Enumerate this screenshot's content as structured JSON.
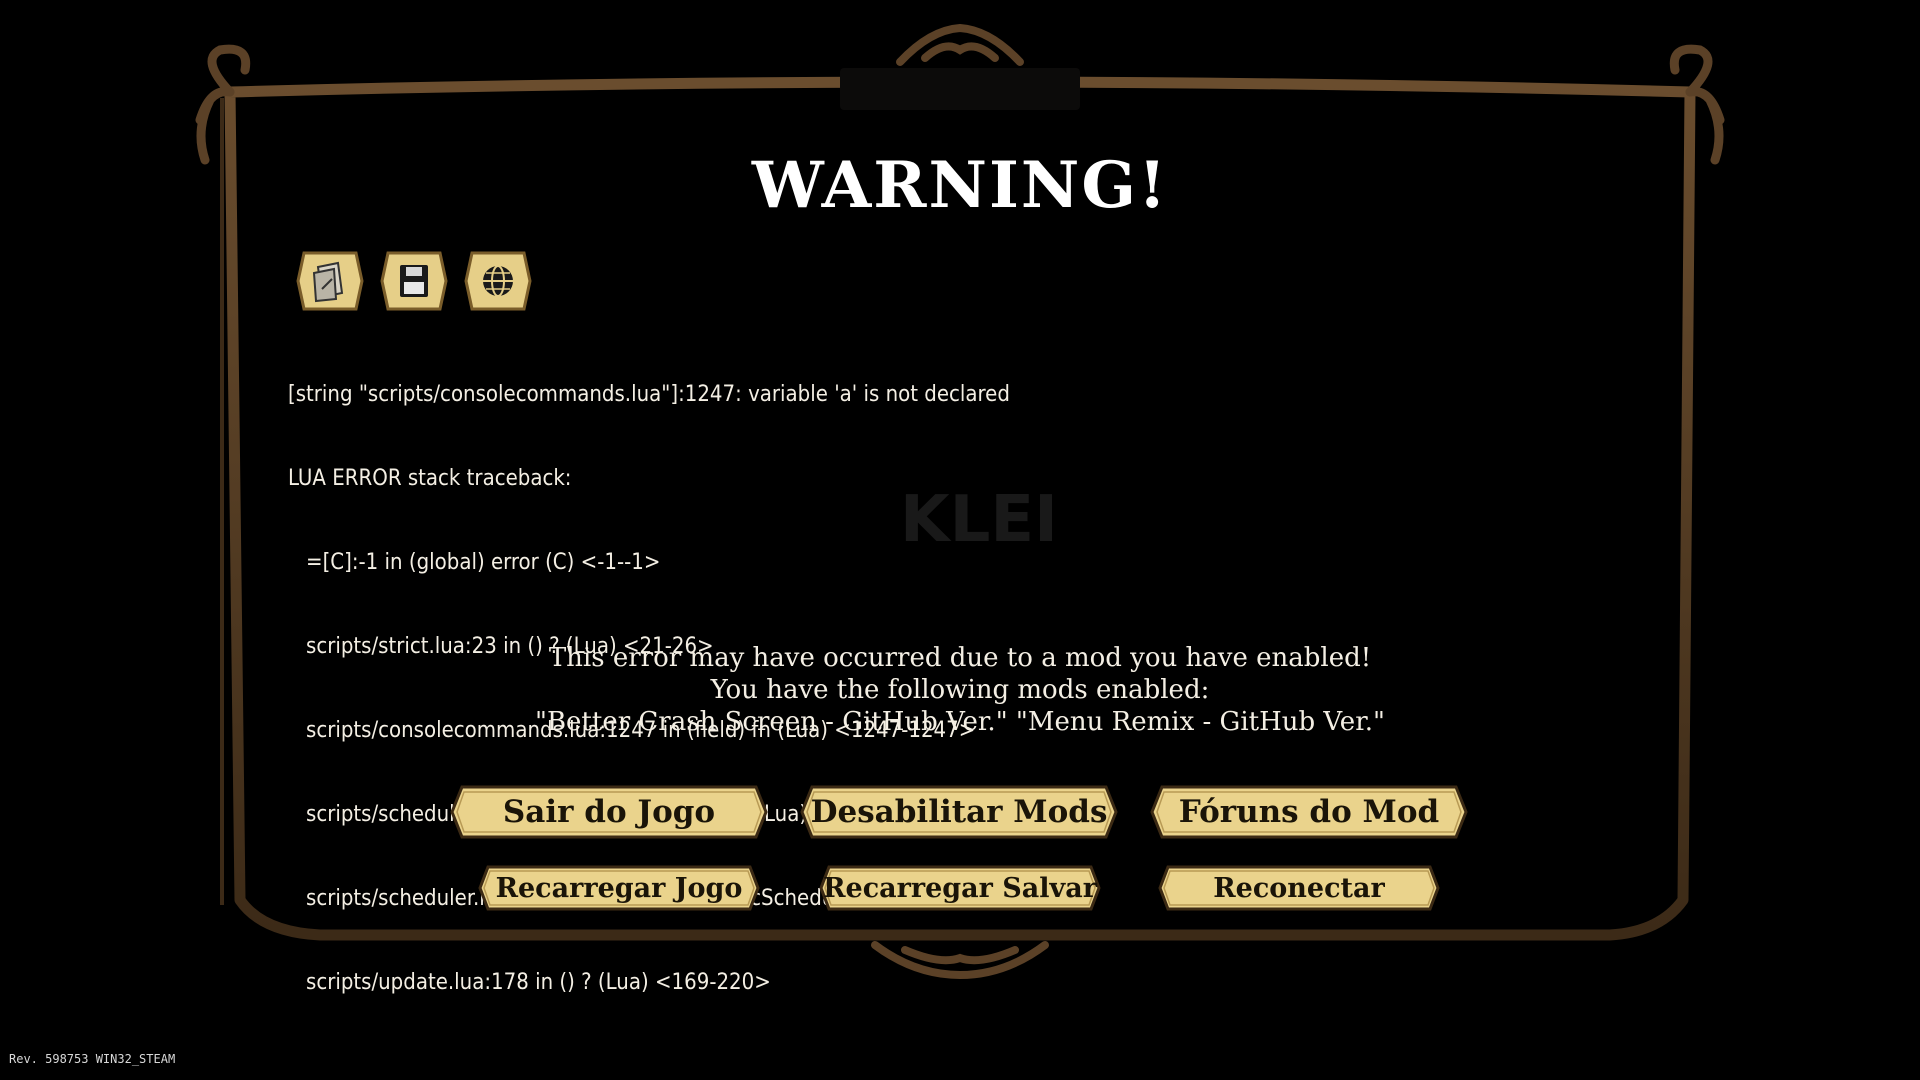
{
  "title": "WARNING!",
  "toolbar": {
    "icons": [
      "open-log-icon",
      "save-disk-icon",
      "globe-icon"
    ]
  },
  "error": {
    "line1": "[string \"scripts/consolecommands.lua\"]:1247: variable 'a' is not declared",
    "line2": "LUA ERROR stack traceback:",
    "trace": [
      "=[C]:-1 in (global) error (C) <-1--1>",
      "scripts/strict.lua:23 in () ? (Lua) <21-26>",
      "scripts/consolecommands.lua:1247 in (field) fn (Lua) <1247-1247>",
      "scripts/scheduler.lua:186 in (method) OnTick (Lua) <164-216>",
      "scripts/scheduler.lua:419 in (global) RunStaticScheduler (Lua) <417-425>",
      "scripts/update.lua:178 in () ? (Lua) <169-220>"
    ]
  },
  "mods": {
    "line1": "This error may have occurred due to a mod you have enabled!",
    "line2": "You have the following mods enabled:",
    "line3": "\"Better Crash Screen - GitHub Ver.\" \"Menu Remix - GitHub Ver.\""
  },
  "buttons": {
    "quit": "Sair do Jogo",
    "disable_mods": "Desabilitar Mods",
    "mod_forums": "Fóruns do Mod",
    "reload_game": "Recarregar Jogo",
    "reload_save": "Recarregar Salvar",
    "reconnect": "Reconectar"
  },
  "watermark": "KLEI",
  "revision": "Rev. 598753 WIN32_STEAM",
  "colors": {
    "frame": "#4a3520",
    "button_gold": "#e9d28a",
    "background": "#000000"
  }
}
